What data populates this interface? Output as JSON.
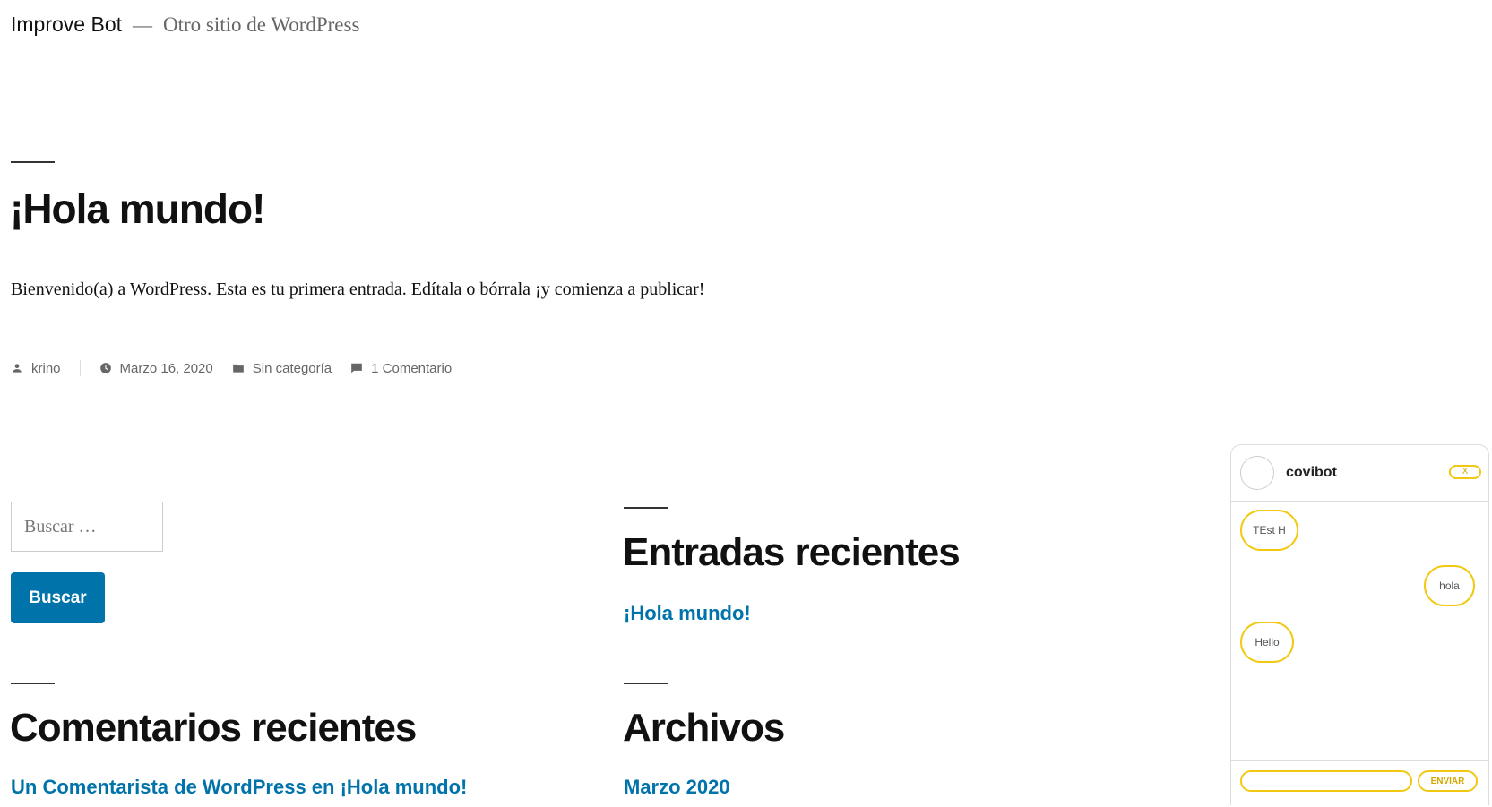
{
  "site": {
    "title": "Improve Bot",
    "separator": "—",
    "description": "Otro sitio de WordPress"
  },
  "post": {
    "title": "¡Hola mundo!",
    "content": "Bienvenido(a) a WordPress. Esta es tu primera entrada. Edítala o bórrala ¡y comienza a publicar!",
    "meta": {
      "author": "krino",
      "date": "Marzo 16, 2020",
      "category": "Sin categoría",
      "comments": "1 Comentario"
    }
  },
  "search": {
    "placeholder": "Buscar …",
    "button_label": "Buscar"
  },
  "widgets": {
    "recent_posts": {
      "title": "Entradas recientes",
      "items": [
        "¡Hola mundo!"
      ]
    },
    "recent_comments": {
      "title": "Comentarios recientes",
      "items": [
        "Un Comentarista de WordPress en ¡Hola mundo!"
      ]
    },
    "archives": {
      "title": "Archivos",
      "items": [
        "Marzo 2020"
      ]
    }
  },
  "chat": {
    "bot_name": "covibot",
    "close_label": "X",
    "messages": [
      {
        "text": "TEst H",
        "side": "left"
      },
      {
        "text": "hola",
        "side": "right"
      },
      {
        "text": "Hello",
        "side": "left"
      }
    ],
    "input_value": "",
    "send_label": "ENVIAR",
    "accent_color": "#f2c811"
  },
  "colors": {
    "link": "#0073aa",
    "button": "#0073aa",
    "text": "#111111",
    "muted": "#666666"
  }
}
